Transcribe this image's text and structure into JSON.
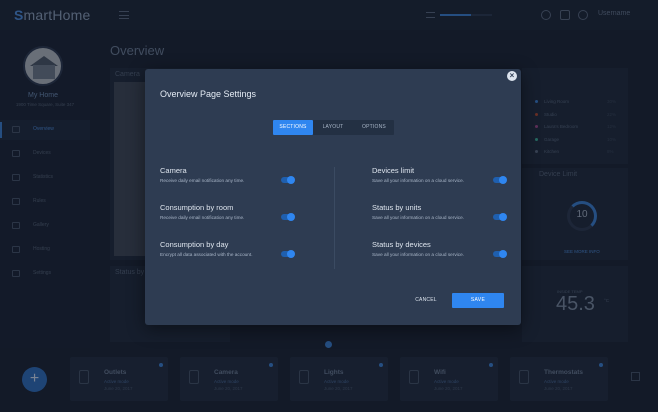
{
  "app": {
    "logo_prefix": "S",
    "logo_rest": "martHome",
    "username": "Username",
    "top_progress_percent": 60
  },
  "sidebar": {
    "home_name": "My Home",
    "home_address": "1900 Time Square, Suite 347",
    "items": [
      {
        "label": "Overview",
        "icon": "grid-icon",
        "active": true
      },
      {
        "label": "Devices",
        "icon": "device-icon"
      },
      {
        "label": "Statistics",
        "icon": "chart-icon"
      },
      {
        "label": "Rules",
        "icon": "rules-icon"
      },
      {
        "label": "Gallery",
        "icon": "gallery-icon"
      },
      {
        "label": "Hosting",
        "icon": "cloud-icon"
      },
      {
        "label": "Settings",
        "icon": "gear-icon"
      }
    ]
  },
  "main": {
    "title": "Overview",
    "camera_card_title": "Camera",
    "stats_card_title": "Status by",
    "legend": [
      {
        "label": "Living Room",
        "value": "30%",
        "color": "#3b82d6"
      },
      {
        "label": "Studio",
        "value": "22%",
        "color": "#b4492f"
      },
      {
        "label": "Laura's Bedroom",
        "value": "12%",
        "color": "#a34a8c"
      },
      {
        "label": "Garage",
        "value": "10%",
        "color": "#3cb39a"
      },
      {
        "label": "Kitchen",
        "value": "8%",
        "color": "#5b6b82"
      }
    ],
    "devices_limit_title": "Device Limit",
    "devices_limit_value": "10",
    "see_more": "SEE MORE INFO",
    "temperature_label": "INSIDE TEMP",
    "temperature_value": "45.3",
    "temperature_unit": "°C"
  },
  "devices": [
    {
      "name": "Outlets",
      "status": "Active mode",
      "date": "June 20, 2017"
    },
    {
      "name": "Camera",
      "status": "Active mode",
      "date": "June 20, 2017"
    },
    {
      "name": "Lights",
      "status": "Active mode",
      "date": "June 20, 2017"
    },
    {
      "name": "Wifi",
      "status": "Active mode",
      "date": "June 20, 2017"
    },
    {
      "name": "Thermostats",
      "status": "Active mode",
      "date": "June 20, 2017"
    }
  ],
  "modal": {
    "title": "Overview Page Settings",
    "close_label": "×",
    "tabs": [
      {
        "label": "SECTIONS",
        "active": true
      },
      {
        "label": "LAYOUT",
        "active": false
      },
      {
        "label": "OPTIONS",
        "active": false
      }
    ],
    "left_settings": [
      {
        "title": "Camera",
        "desc": "Receive daily email notification any time.",
        "enabled": true
      },
      {
        "title": "Consumption by room",
        "desc": "Receive daily email notification any time.",
        "enabled": true
      },
      {
        "title": "Consumption by day",
        "desc": "Encrypt all data associated with the account.",
        "enabled": true
      }
    ],
    "right_settings": [
      {
        "title": "Devices limit",
        "desc": "Save all your information on a cloud service.",
        "enabled": true
      },
      {
        "title": "Status by units",
        "desc": "Save all your information on a cloud service.",
        "enabled": true
      },
      {
        "title": "Status by devices",
        "desc": "Save all your information on a cloud service.",
        "enabled": true
      }
    ],
    "cancel_label": "CANCEL",
    "save_label": "SAVE"
  },
  "colors": {
    "accent": "#2f86f0",
    "background": "#1a2333",
    "modal_background": "#2e3c52"
  }
}
